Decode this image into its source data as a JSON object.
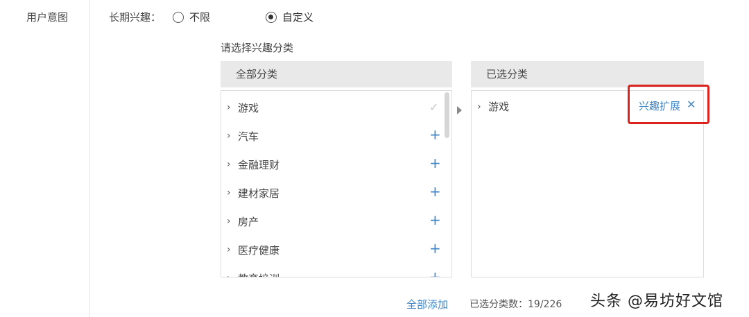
{
  "sidebar": {
    "label": "用户意图"
  },
  "long_term_interest": {
    "label": "长期兴趣：",
    "options": [
      {
        "label": "不限",
        "checked": false
      },
      {
        "label": "自定义",
        "checked": true
      }
    ]
  },
  "hint": "请选择兴趣分类",
  "all_categories": {
    "header": "全部分类",
    "items": [
      {
        "label": "游戏",
        "action": "check"
      },
      {
        "label": "汽车",
        "action": "add"
      },
      {
        "label": "金融理财",
        "action": "add"
      },
      {
        "label": "建材家居",
        "action": "add"
      },
      {
        "label": "房产",
        "action": "add"
      },
      {
        "label": "医疗健康",
        "action": "add"
      },
      {
        "label": "教育培训",
        "action": "add"
      }
    ]
  },
  "selected_categories": {
    "header": "已选分类",
    "items": [
      {
        "label": "游戏"
      }
    ],
    "expand_link": "兴趣扩展",
    "close_glyph": "✕"
  },
  "footer": {
    "add_all": "全部添加",
    "selected_count": "已选分类数：19/226"
  },
  "icons": {
    "chevron": "›",
    "check": "✓",
    "add": "+"
  },
  "watermark": "头条 @易坊好文馆"
}
